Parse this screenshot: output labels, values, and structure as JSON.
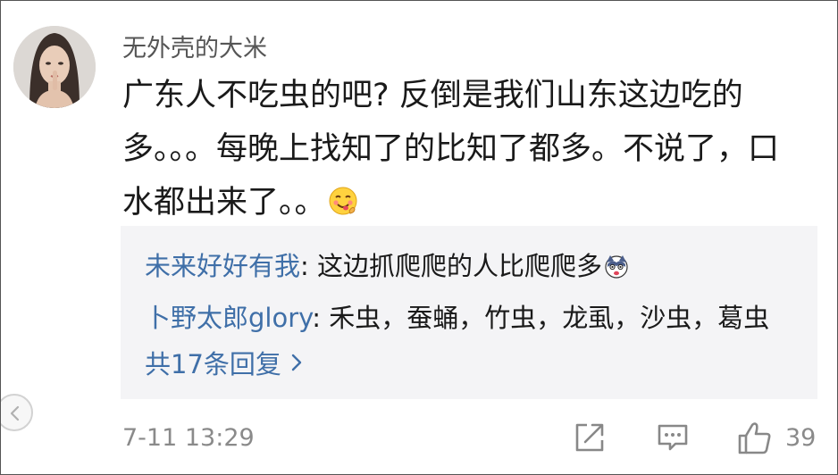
{
  "comment": {
    "username": "无外壳的大米",
    "text_lines": [
      "广东人不吃虫的吧? 反倒是我们山东这边吃的",
      "多。。。每晚上找知了的比知了都多。不说了，口",
      "水都出来了。。"
    ],
    "emoji_icon": "yummy-face-emoji",
    "timestamp": "7-11 13:29",
    "like_count": "39"
  },
  "replies": {
    "items": [
      {
        "name": "未来好好有我",
        "sep": ": ",
        "text": "这边抓爬爬的人比爬爬多",
        "emoji_icon": "surprised-dog-emoji"
      },
      {
        "name": "卜野太郎glory",
        "sep": ": ",
        "text": "禾虫，蚕蛹，竹虫，龙虱，沙虫，葛虫"
      }
    ],
    "more_label": "共17条回复",
    "more_icon": "chevron-right-icon"
  },
  "actions": {
    "share_icon": "share-icon",
    "reply_icon": "comment-icon",
    "like_icon": "thumbs-up-icon",
    "back_icon": "back-arrow-icon"
  },
  "colors": {
    "link": "#3f6fa8",
    "reply_bg": "#f4f4f6",
    "meta_text": "#8a8a8a"
  }
}
